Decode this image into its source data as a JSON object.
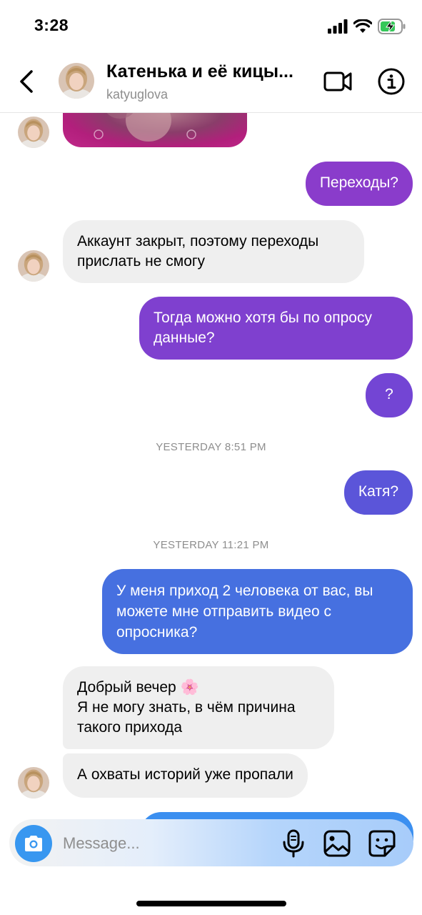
{
  "status_bar": {
    "time": "3:28"
  },
  "header": {
    "title": "Катенька и её кицы...",
    "username": "katyuglova",
    "icons": {
      "back": "chevron-left-icon",
      "video": "video-camera-icon",
      "info": "info-icon"
    }
  },
  "messages": [
    {
      "type": "media",
      "direction": "in"
    },
    {
      "direction": "out",
      "text": "Переходы?",
      "color": "#8a3ccb"
    },
    {
      "direction": "in",
      "text": "Аккаунт закрыт, поэтому переходы прислать не смогу"
    },
    {
      "direction": "out",
      "text": "Тогда можно хотя бы по опросу данные?",
      "color": "#7f40cf"
    },
    {
      "direction": "out",
      "text": "?",
      "color": "#7345d4"
    },
    {
      "type": "timestamp",
      "text": "YESTERDAY 8:51 PM"
    },
    {
      "direction": "out",
      "text": "Катя?",
      "color": "#5b55d9"
    },
    {
      "type": "timestamp",
      "text": "YESTERDAY 11:21 PM"
    },
    {
      "direction": "out",
      "text": "У меня приход 2 человека от вас, вы можете мне отправить видео с опросника?",
      "color": "#4670e0"
    },
    {
      "direction": "in",
      "text_line1": "Добрый вечер 🌸",
      "text_line2": "Я не могу знать, в чём причина такого прихода"
    },
    {
      "direction": "in",
      "text": "А охваты историй уже пропали"
    }
  ],
  "composer": {
    "placeholder": "Message...",
    "icons": {
      "camera": "camera-icon",
      "mic": "microphone-icon",
      "gallery": "image-icon",
      "sticker": "sticker-icon"
    }
  },
  "colors": {
    "accent_blue": "#3897f0",
    "bubble_incoming": "#efefef"
  }
}
